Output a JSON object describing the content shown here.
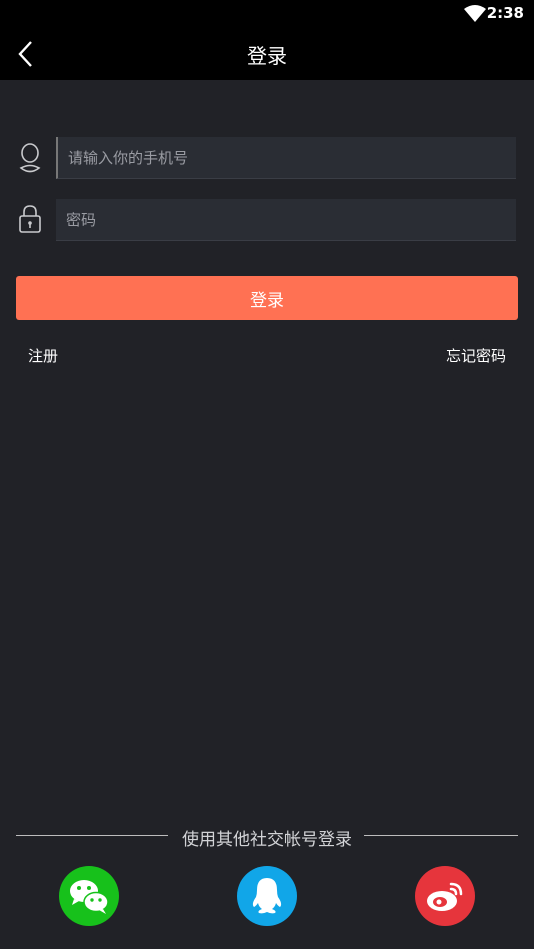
{
  "status_bar": {
    "time": "2:38"
  },
  "header": {
    "title": "登录",
    "back_icon": "back-arrow-icon"
  },
  "form": {
    "phone_placeholder": "请输入你的手机号",
    "phone_icon": "user-icon",
    "password_placeholder": "密码",
    "password_icon": "lock-icon",
    "login_label": "登录",
    "register_label": "注册",
    "forgot_label": "忘记密码"
  },
  "social": {
    "label": "使用其他社交帐号登录",
    "providers": [
      {
        "name": "wechat",
        "icon": "wechat-icon",
        "color": "#17c11b"
      },
      {
        "name": "qq",
        "icon": "qq-icon",
        "color": "#11a6e8"
      },
      {
        "name": "weibo",
        "icon": "weibo-icon",
        "color": "#e6353c"
      }
    ]
  },
  "colors": {
    "background": "#212227",
    "header": "#000000",
    "accent": "#ff7153"
  }
}
